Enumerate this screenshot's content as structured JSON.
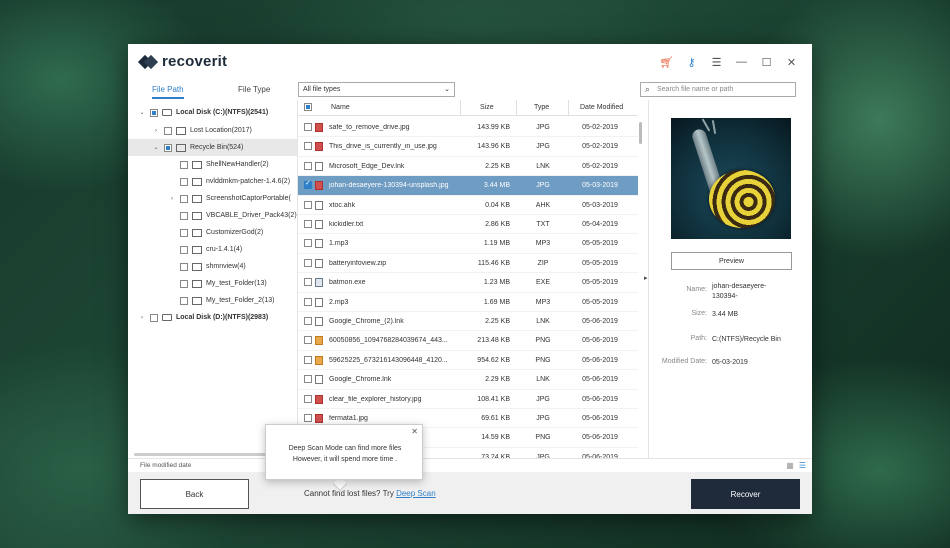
{
  "app": {
    "name": "recoverit"
  },
  "window_controls": {
    "cart_icon": "cart-icon",
    "key_icon": "key-icon",
    "menu_icon": "menu-icon",
    "minimize_icon": "minimize-icon",
    "maximize_icon": "maximize-icon",
    "close_icon": "close-icon"
  },
  "tabs": [
    {
      "label": "File Path",
      "active": true
    },
    {
      "label": "File Type",
      "active": false
    }
  ],
  "filter": {
    "selected": "All file types"
  },
  "search": {
    "placeholder": "Search file name or path"
  },
  "tree": [
    {
      "label": "Local Disk (C:)(NTFS)(2541)",
      "expanded": true,
      "bold": true,
      "check": "partial"
    },
    {
      "label": "Lost Location(2017)",
      "expanded": false,
      "check": "none"
    },
    {
      "label": "Recycle Bin(524)",
      "expanded": true,
      "selected": true,
      "check": "partial"
    },
    {
      "label": "ShellNewHandler(2)",
      "check": "none"
    },
    {
      "label": "nvlddmkm-patcher-1.4.6(2)",
      "check": "none"
    },
    {
      "label": "ScreenshotCaptorPortable(",
      "expanded": false,
      "check": "none"
    },
    {
      "label": "VBCABLE_Driver_Pack43(2)",
      "check": "none"
    },
    {
      "label": "CustomizerGod(2)",
      "check": "none"
    },
    {
      "label": "cru-1.4.1(4)",
      "check": "none"
    },
    {
      "label": "shmnview(4)",
      "check": "none"
    },
    {
      "label": "My_test_Folder(13)",
      "check": "none"
    },
    {
      "label": "My_test_Folder_2(13)",
      "check": "none"
    },
    {
      "label": "Local Disk (D:)(NTFS)(2983)",
      "expanded": false,
      "bold": true,
      "check": "none"
    }
  ],
  "columns": {
    "name": "Name",
    "size": "Size",
    "type": "Type",
    "date": "Date Modified"
  },
  "files": [
    {
      "name": "safe_to_remove_drive.jpg",
      "size": "143.99  KB",
      "type": "JPG",
      "date": "05-02-2019",
      "icon": "img"
    },
    {
      "name": "This_drive_is_currently_in_use.jpg",
      "size": "143.96  KB",
      "type": "JPG",
      "date": "05-02-2019",
      "icon": "img"
    },
    {
      "name": "Microsoft_Edge_Dev.lnk",
      "size": "2.25  KB",
      "type": "LNK",
      "date": "05-02-2019",
      "icon": "doc"
    },
    {
      "name": "johan-desaeyere-130394-unsplash.jpg",
      "size": "3.44  MB",
      "type": "JPG",
      "date": "05-03-2019",
      "icon": "img",
      "selected": true
    },
    {
      "name": "xtoc.ahk",
      "size": "0.04  KB",
      "type": "AHK",
      "date": "05-03-2019",
      "icon": "doc"
    },
    {
      "name": "kickidler.txt",
      "size": "2.86  KB",
      "type": "TXT",
      "date": "05-04-2019",
      "icon": "doc"
    },
    {
      "name": "1.mp3",
      "size": "1.19  MB",
      "type": "MP3",
      "date": "05-05-2019",
      "icon": "doc"
    },
    {
      "name": "batteryinfoview.zip",
      "size": "115.46  KB",
      "type": "ZIP",
      "date": "05-05-2019",
      "icon": "doc"
    },
    {
      "name": "batmon.exe",
      "size": "1.23  MB",
      "type": "EXE",
      "date": "05-05-2019",
      "icon": "exe"
    },
    {
      "name": "2.mp3",
      "size": "1.69  MB",
      "type": "MP3",
      "date": "05-05-2019",
      "icon": "doc"
    },
    {
      "name": "Google_Chrome_(2).lnk",
      "size": "2.25  KB",
      "type": "LNK",
      "date": "05-06-2019",
      "icon": "doc"
    },
    {
      "name": "60050856_1094768284039674_443...",
      "size": "213.48  KB",
      "type": "PNG",
      "date": "05-06-2019",
      "icon": "png"
    },
    {
      "name": "59625225_673216143096448_4120...",
      "size": "954.62  KB",
      "type": "PNG",
      "date": "05-06-2019",
      "icon": "png"
    },
    {
      "name": "Google_Chrome.lnk",
      "size": "2.29  KB",
      "type": "LNK",
      "date": "05-06-2019",
      "icon": "doc"
    },
    {
      "name": "clear_file_explorer_history.jpg",
      "size": "108.41  KB",
      "type": "JPG",
      "date": "05-06-2019",
      "icon": "img"
    },
    {
      "name": "fermata1.jpg",
      "size": "69.61  KB",
      "type": "JPG",
      "date": "05-06-2019",
      "icon": "img"
    },
    {
      "name": "48_9125...",
      "size": "14.59  KB",
      "type": "PNG",
      "date": "05-06-2019",
      "icon": "png"
    },
    {
      "name": "",
      "size": "73.24  KB",
      "type": "JPG",
      "date": "05-06-2019",
      "icon": "img"
    }
  ],
  "preview": {
    "button": "Preview",
    "name_label": "Name:",
    "name_value": "johan-desaeyere-130394-",
    "size_label": "Size:",
    "size_value": "3.44  MB",
    "path_label": "Path:",
    "path_value": "C:(NTFS)/Recycle Bin",
    "date_label": "Modified Date:",
    "date_value": "05-03-2019"
  },
  "status": {
    "text": "File modified date"
  },
  "tooltip": {
    "line1": "Deep Scan Mode can find more files",
    "line2": "However, it will spend more time ."
  },
  "footer": {
    "back": "Back",
    "message": "Cannot find lost files? Try",
    "link": "Deep Scan",
    "recover": "Recover"
  }
}
